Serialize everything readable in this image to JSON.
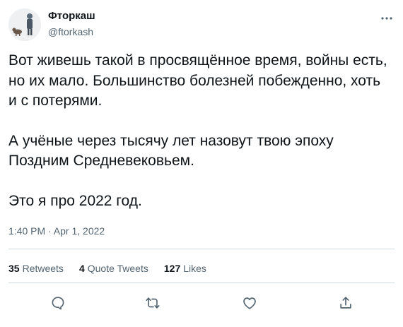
{
  "author": {
    "name": "Фторкаш",
    "handle": "@ftorkash"
  },
  "tweet": {
    "paragraphs": [
      "Вот живешь такой в просвящённое время, войны есть, но их мало. Большинство болезней побежденно, хоть и с потерями.",
      "А учёные через тысячу лет назовут твою эпоху Поздним Средневековьем.",
      "Это я про 2022 год."
    ],
    "timestamp": "1:40 PM · Apr 1, 2022"
  },
  "stats": {
    "retweets": {
      "count": "35",
      "label": "Retweets"
    },
    "quotes": {
      "count": "4",
      "label": "Quote Tweets"
    },
    "likes": {
      "count": "127",
      "label": "Likes"
    }
  },
  "actions": [
    {
      "icon": "reply-icon"
    },
    {
      "icon": "retweet-icon"
    },
    {
      "icon": "like-icon"
    },
    {
      "icon": "share-icon"
    }
  ],
  "colors": {
    "text": "#0f1419",
    "secondary": "#536471",
    "divider": "#cfd9de"
  }
}
